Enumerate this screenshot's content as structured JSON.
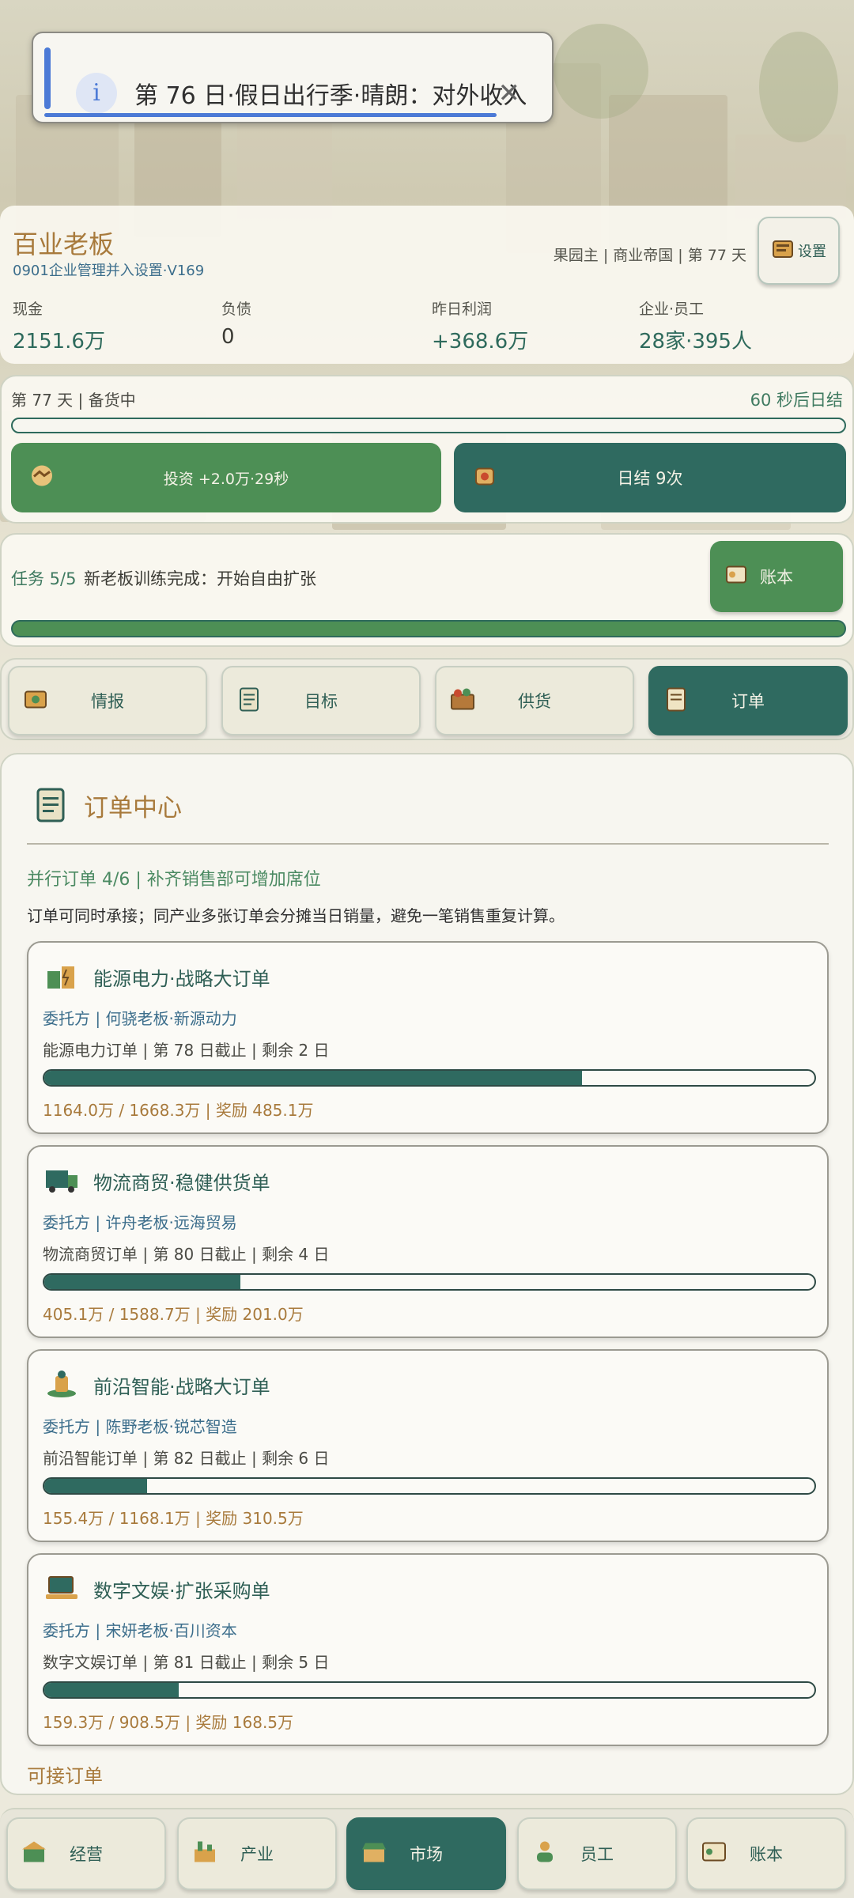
{
  "toast": {
    "message": "第 76 日·假日出行季·晴朗：对外收入",
    "info_glyph": "i",
    "close_glyph": "✕"
  },
  "header": {
    "title": "百业老板",
    "subtitle": "0901企业管理并入设置·V169",
    "meta": "果园主 | 商业帝国 | 第 77 天",
    "settings_label": "设置",
    "stats": [
      {
        "label": "现金",
        "value": "2151.6万"
      },
      {
        "label": "负债",
        "value": "0"
      },
      {
        "label": "昨日利润",
        "value": "+368.6万"
      },
      {
        "label": "企业·员工",
        "value": "28家·395人"
      }
    ]
  },
  "day": {
    "status": "第 77 天 | 备货中",
    "countdown": "60 秒后日结",
    "invest_label": "投资 +2.0万·29秒",
    "settle_label": "日结 9次"
  },
  "task": {
    "label": "任务 5/5",
    "text": "新老板训练完成：开始自由扩张",
    "ledger_label": "账本",
    "progress": 1.0
  },
  "tabs": [
    {
      "label": "情报",
      "icon": "intel-icon"
    },
    {
      "label": "目标",
      "icon": "clipboard-icon"
    },
    {
      "label": "供货",
      "icon": "crate-icon"
    },
    {
      "label": "订单",
      "icon": "order-icon",
      "active": true
    }
  ],
  "orders_panel": {
    "title": "订单中心",
    "parallel": "并行订单 4/6 | 补齐销售部可增加席位",
    "note": "订单可同时承接；同产业多张订单会分摊当日销量，避免一笔销售重复计算。",
    "available_label": "可接订单"
  },
  "orders": [
    {
      "title": "能源电力·战略大订单",
      "client": "委托方 | 何骁老板·新源动力",
      "info": "能源电力订单 | 第 78 日截止 | 剩余 2 日",
      "amount": "1164.0万 / 1668.3万 | 奖励 485.1万",
      "progress": 0.698,
      "icon": "energy-icon"
    },
    {
      "title": "物流商贸·稳健供货单",
      "client": "委托方 | 许舟老板·远海贸易",
      "info": "物流商贸订单 | 第 80 日截止 | 剩余 4 日",
      "amount": " 405.1万 / 1588.7万 | 奖励 201.0万",
      "progress": 0.255,
      "icon": "truck-icon"
    },
    {
      "title": "前沿智能·战略大订单",
      "client": "委托方 | 陈野老板·锐芯智造",
      "info": "前沿智能订单 | 第 82 日截止 | 剩余 6 日",
      "amount": "155.4万 / 1168.1万 | 奖励 310.5万",
      "progress": 0.133,
      "icon": "ai-icon"
    },
    {
      "title": "数字文娱·扩张采购单",
      "client": "委托方 | 宋妍老板·百川资本",
      "info": "数字文娱订单 | 第 81 日截止 | 剩余 5 日",
      "amount": "159.3万 / 908.5万 | 奖励 168.5万",
      "progress": 0.175,
      "icon": "laptop-icon"
    }
  ],
  "bottom_nav": [
    {
      "label": "经营",
      "icon": "business-icon"
    },
    {
      "label": "产业",
      "icon": "industry-icon"
    },
    {
      "label": "市场",
      "icon": "market-icon",
      "active": true
    },
    {
      "label": "员工",
      "icon": "staff-icon"
    },
    {
      "label": "账本",
      "icon": "ledger-icon"
    }
  ],
  "colors": {
    "accent_green": "#2f6a60",
    "button_green": "#4d8f55",
    "gold_text": "#a87a3c",
    "info_blue": "#4c7ad6"
  }
}
